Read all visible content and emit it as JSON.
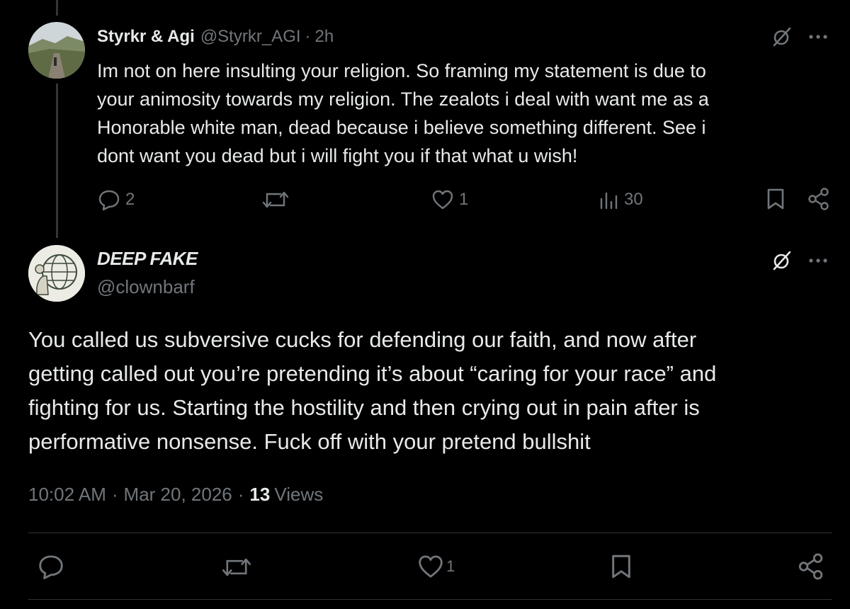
{
  "tweet1": {
    "display_name": "Styrkr & Agi",
    "handle": "@Styrkr_AGI",
    "separator": "·",
    "time": "2h",
    "text": "Im not on here insulting your religion. So framing my statement is due to\nyour animosity towards my religion. The zealots i deal with want me as a\nHonorable white man, dead because i believe something different. See i\ndont want you dead but i will fight you if that what u wish!",
    "replies": "2",
    "likes": "1",
    "views": "30"
  },
  "tweet2": {
    "display_name": "DEEP FAKE",
    "handle": "@clownbarf",
    "text": "You called us subversive cucks for defending our faith, and now after\ngetting called out you’re pretending it’s about “caring for your race” and\nfighting for us. Starting the hostility and then crying out in pain after is\nperformative nonsense. Fuck off with your pretend bullshit",
    "time": "10:02 AM",
    "sep1": "·",
    "date": "Mar 20, 2026",
    "sep2": "·",
    "views_count": "13",
    "views_label": "Views",
    "likes": "1"
  },
  "icons": {
    "more": "more-dots-icon",
    "grok": "grok-icon",
    "reply": "reply-icon",
    "retweet": "retweet-icon",
    "like": "heart-icon",
    "views": "views-icon",
    "bookmark": "bookmark-icon",
    "share": "share-icon"
  },
  "colors": {
    "background": "#000000",
    "text": "#e7e9ea",
    "muted": "#71767b",
    "divider": "#2f3336"
  }
}
